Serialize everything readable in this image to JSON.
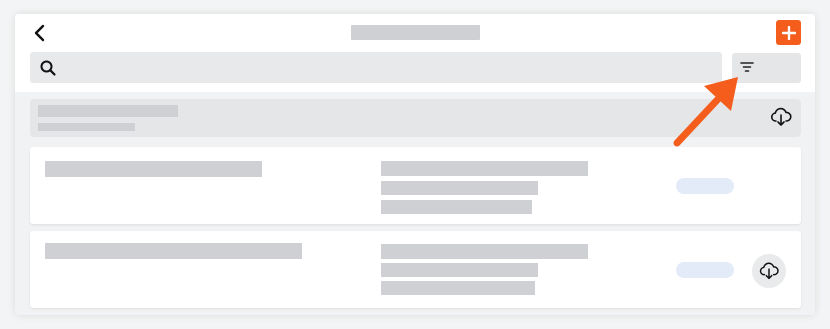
{
  "search": {
    "placeholder": ""
  },
  "icons": {
    "back": "chevron-left-icon",
    "add": "plus-icon",
    "search": "search-icon",
    "filter": "filter-icon",
    "download": "cloud-download-icon"
  },
  "colors": {
    "accent": "#f45d1c",
    "placeholder": "#cfd0d4",
    "pill": "#e3ebf9",
    "annotation_arrow": "#f45d1c"
  },
  "list": {
    "row_count": 2
  }
}
